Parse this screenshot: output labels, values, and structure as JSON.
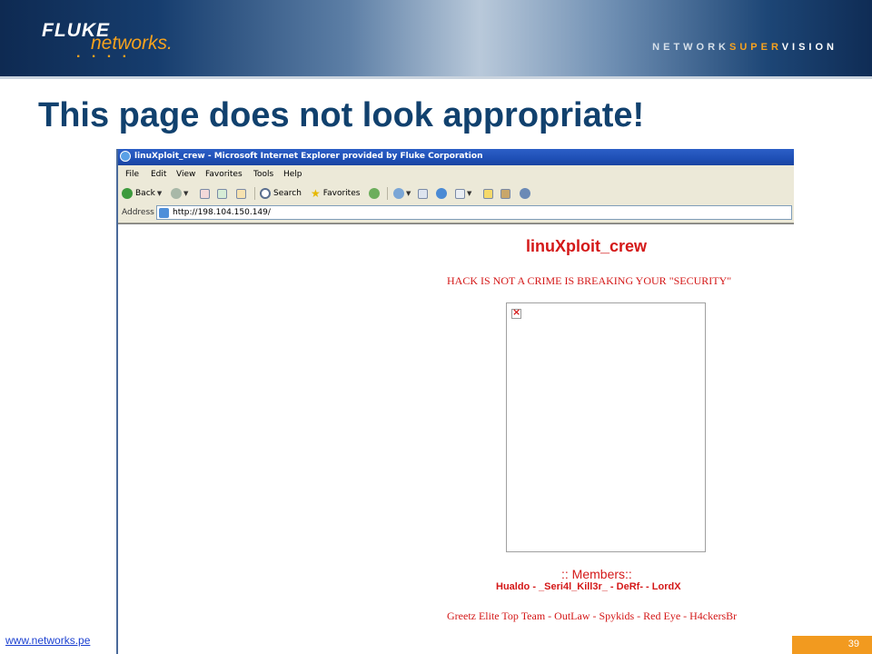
{
  "slide": {
    "logo_fluke": "FLUKE",
    "logo_networks": "networks.",
    "logo_dots": ". . . .",
    "tagline_network": "NETWORK",
    "tagline_super": "SUPER",
    "tagline_vision": "VISION",
    "title": "This page does not look appropriate!",
    "footer_url": "www.networks.pe",
    "page_number": "39"
  },
  "browser": {
    "window_title": "linuXploit_crew - Microsoft Internet Explorer provided by Fluke Corporation",
    "menu": [
      "File",
      "Edit",
      "View",
      "Favorites",
      "Tools",
      "Help"
    ],
    "toolbar": {
      "back_label": "Back",
      "search_label": "Search",
      "favorites_label": "Favorites"
    },
    "address_label": "Address",
    "address_url": "http://198.104.150.149/"
  },
  "webpage": {
    "crew_title": "linuXploit_crew",
    "hack_message": "HACK IS NOT A CRIME IS BREAKING YOUR \"SECURITY\"",
    "members_title": ":: Members::",
    "members_names": "Hualdo - _Seri4l_Kill3r_ - DeRf- - LordX",
    "greetz": "Greetz Elite Top Team - OutLaw - Spykids - Red Eye - H4ckersBr"
  },
  "colors": {
    "title_blue": "#11416e",
    "accent_orange": "#f29a1f",
    "hack_red": "#d41818",
    "ie_titlebar": "#1e4fb5"
  }
}
